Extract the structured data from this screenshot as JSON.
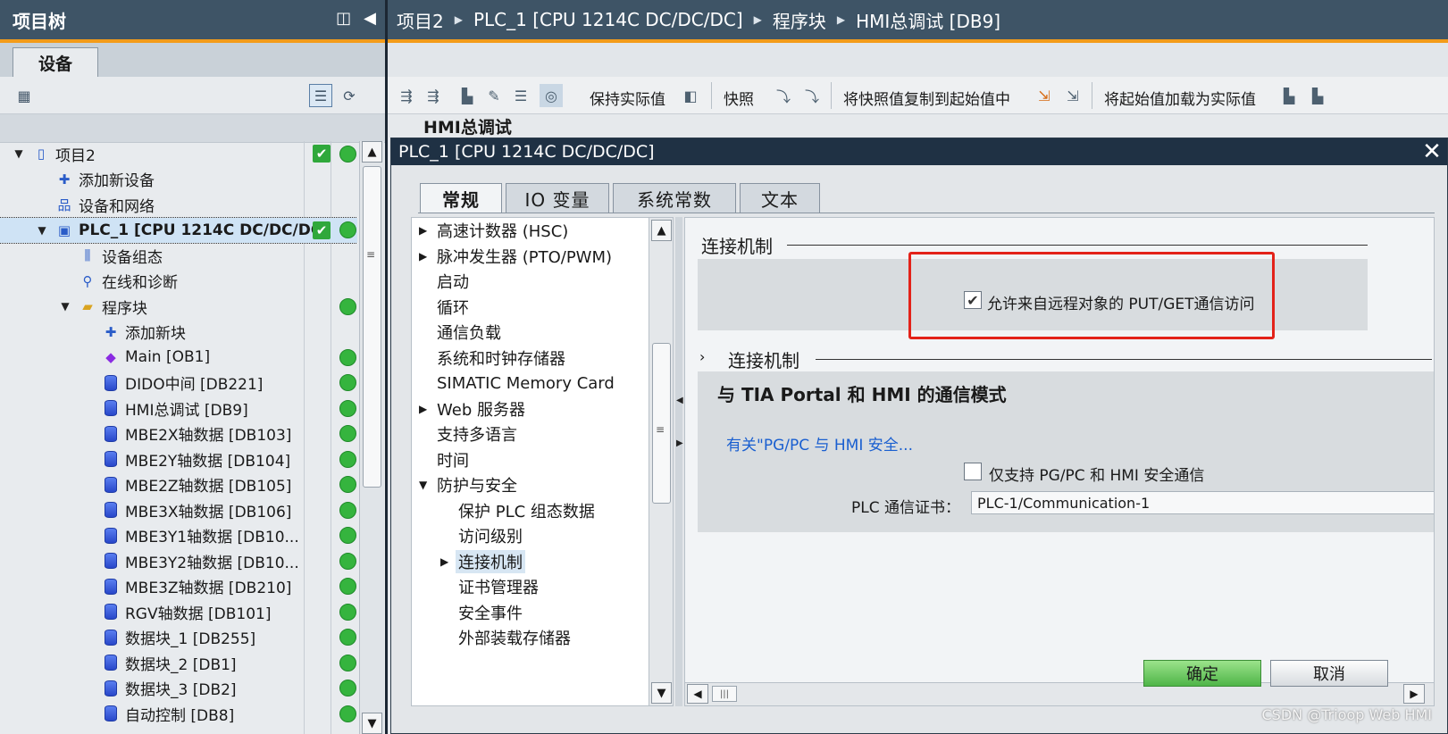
{
  "project_tree": {
    "title": "项目树",
    "tab": "设备",
    "items": [
      {
        "label": "项目2",
        "level": 0,
        "expander": "▼",
        "icon": "project-icon",
        "status_check": true,
        "status_dot": true
      },
      {
        "label": "添加新设备",
        "level": 1,
        "expander": "",
        "icon": "add-device-icon"
      },
      {
        "label": "设备和网络",
        "level": 1,
        "expander": "",
        "icon": "network-icon"
      },
      {
        "label": "PLC_1 [CPU 1214C DC/DC/DC]",
        "level": 1,
        "expander": "▼",
        "icon": "plc-icon",
        "status_check": true,
        "status_dot": true,
        "selected": true
      },
      {
        "label": "设备组态",
        "level": 2,
        "expander": "",
        "icon": "device-config-icon"
      },
      {
        "label": "在线和诊断",
        "level": 2,
        "expander": "",
        "icon": "diagnostics-icon"
      },
      {
        "label": "程序块",
        "level": 2,
        "expander": "▼",
        "icon": "folder-icon",
        "status_dot": true
      },
      {
        "label": "添加新块",
        "level": 3,
        "expander": "",
        "icon": "add-block-icon"
      },
      {
        "label": "Main [OB1]",
        "level": 3,
        "expander": "",
        "icon": "ob-icon",
        "status_dot": true
      },
      {
        "label": "DIDO中间 [DB221]",
        "level": 3,
        "expander": "",
        "icon": "db-icon",
        "status_dot": true
      },
      {
        "label": "HMI总调试 [DB9]",
        "level": 3,
        "expander": "",
        "icon": "db-icon",
        "status_dot": true
      },
      {
        "label": "MBE2X轴数据 [DB103]",
        "level": 3,
        "expander": "",
        "icon": "db-icon",
        "status_dot": true
      },
      {
        "label": "MBE2Y轴数据 [DB104]",
        "level": 3,
        "expander": "",
        "icon": "db-icon",
        "status_dot": true
      },
      {
        "label": "MBE2Z轴数据 [DB105]",
        "level": 3,
        "expander": "",
        "icon": "db-icon",
        "status_dot": true
      },
      {
        "label": "MBE3X轴数据 [DB106]",
        "level": 3,
        "expander": "",
        "icon": "db-icon",
        "status_dot": true
      },
      {
        "label": "MBE3Y1轴数据 [DB10...",
        "level": 3,
        "expander": "",
        "icon": "db-icon",
        "status_dot": true
      },
      {
        "label": "MBE3Y2轴数据 [DB10...",
        "level": 3,
        "expander": "",
        "icon": "db-icon",
        "status_dot": true
      },
      {
        "label": "MBE3Z轴数据 [DB210]",
        "level": 3,
        "expander": "",
        "icon": "db-icon",
        "status_dot": true
      },
      {
        "label": "RGV轴数据 [DB101]",
        "level": 3,
        "expander": "",
        "icon": "db-icon",
        "status_dot": true
      },
      {
        "label": "数据块_1 [DB255]",
        "level": 3,
        "expander": "",
        "icon": "db-icon",
        "status_dot": true
      },
      {
        "label": "数据块_2 [DB1]",
        "level": 3,
        "expander": "",
        "icon": "db-icon",
        "status_dot": true
      },
      {
        "label": "数据块_3 [DB2]",
        "level": 3,
        "expander": "",
        "icon": "db-icon",
        "status_dot": true
      },
      {
        "label": "自动控制 [DB8]",
        "level": 3,
        "expander": "",
        "icon": "db-icon",
        "status_dot": true
      }
    ]
  },
  "breadcrumb": [
    "项目2",
    "PLC_1 [CPU 1214C DC/DC/DC]",
    "程序块",
    "HMI总调试 [DB9]"
  ],
  "editor_toolbar": {
    "keep_actual": "保持实际值",
    "snapshot": "快照",
    "copy_snapshot": "将快照值复制到起始值中",
    "load_start": "将起始值加载为实际值"
  },
  "editor_subtitle": "HMI总调试",
  "dialog": {
    "title": "PLC_1 [CPU 1214C DC/DC/DC]",
    "tabs": [
      "常规",
      "IO 变量",
      "系统常数",
      "文本"
    ],
    "active_tab": 0,
    "nav": [
      {
        "label": "高速计数器 (HSC)",
        "level": 0,
        "arrow": "▶"
      },
      {
        "label": "脉冲发生器 (PTO/PWM)",
        "level": 0,
        "arrow": "▶"
      },
      {
        "label": "启动",
        "level": 0,
        "arrow": ""
      },
      {
        "label": "循环",
        "level": 0,
        "arrow": ""
      },
      {
        "label": "通信负载",
        "level": 0,
        "arrow": ""
      },
      {
        "label": "系统和时钟存储器",
        "level": 0,
        "arrow": ""
      },
      {
        "label": "SIMATIC Memory Card",
        "level": 0,
        "arrow": ""
      },
      {
        "label": "Web 服务器",
        "level": 0,
        "arrow": "▶"
      },
      {
        "label": "支持多语言",
        "level": 0,
        "arrow": ""
      },
      {
        "label": "时间",
        "level": 0,
        "arrow": ""
      },
      {
        "label": "防护与安全",
        "level": 0,
        "arrow": "▼"
      },
      {
        "label": "保护 PLC 组态数据",
        "level": 1,
        "arrow": ""
      },
      {
        "label": "访问级别",
        "level": 1,
        "arrow": ""
      },
      {
        "label": "连接机制",
        "level": 1,
        "arrow": "▶",
        "selected": true
      },
      {
        "label": "证书管理器",
        "level": 1,
        "arrow": ""
      },
      {
        "label": "安全事件",
        "level": 1,
        "arrow": ""
      },
      {
        "label": "外部装载存储器",
        "level": 1,
        "arrow": ""
      }
    ],
    "section1_title": "连接机制",
    "put_get_label": "允许来自远程对象的 PUT/GET通信访问",
    "put_get_checked": true,
    "section2_arrow": "›",
    "section2_title": "连接机制",
    "hmi_mode_title": "与 TIA Portal 和 HMI 的通信模式",
    "hmi_link": "有关\"PG/PC 与 HMI 安全...",
    "secure_only_label": "仅支持 PG/PC 和 HMI 安全通信",
    "secure_only_checked": false,
    "cert_label": "PLC 通信证书：",
    "cert_value": "PLC-1/Communication-1",
    "ok": "确定",
    "cancel": "取消"
  },
  "watermark": "CSDN @Trioop Web HMI",
  "colors": {
    "header": "#3e5466",
    "accent": "#f39c1a",
    "status_green": "#35b43e",
    "highlight_red": "#e32219",
    "link_blue": "#1a5fd0"
  }
}
